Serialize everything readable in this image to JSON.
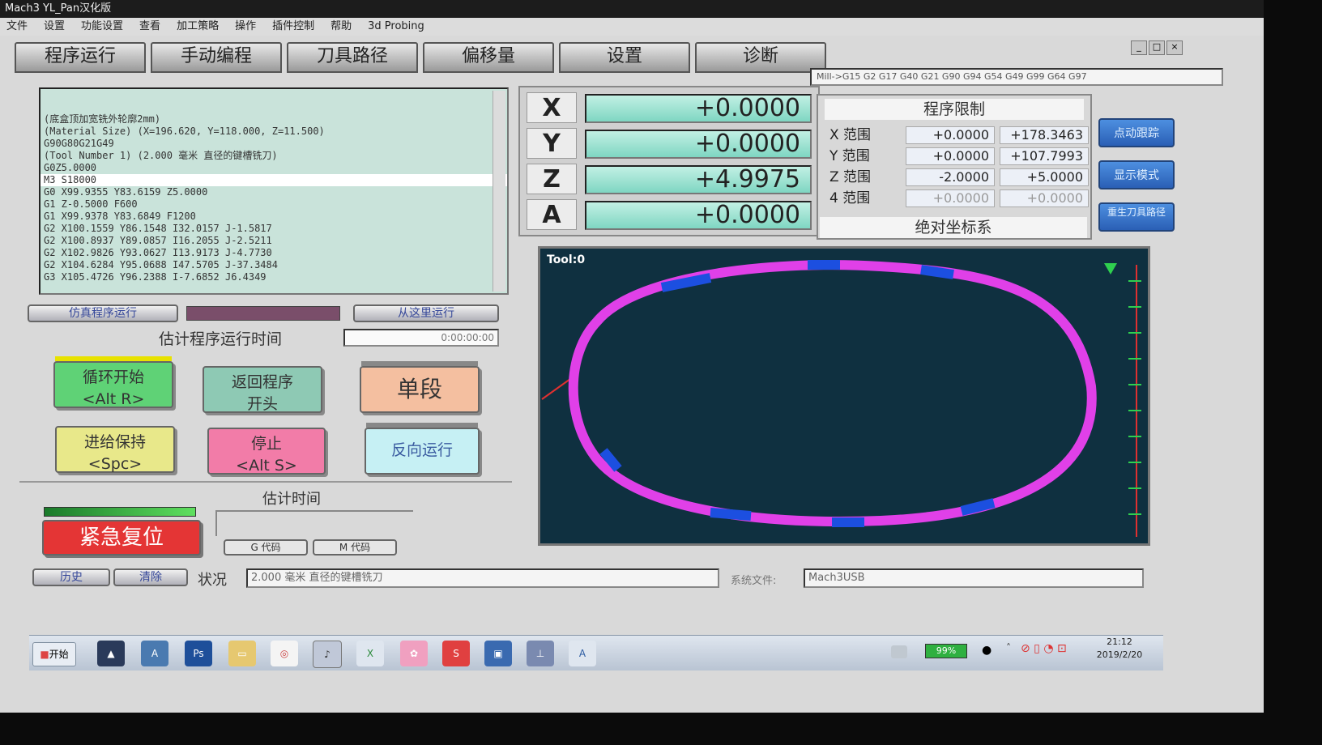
{
  "window": {
    "title": "Mach3 YL_Pan汉化版"
  },
  "menu": [
    "文件",
    "设置",
    "功能设置",
    "查看",
    "加工策略",
    "操作",
    "插件控制",
    "帮助",
    "3d Probing"
  ],
  "tabs": [
    "程序运行",
    "手动编程",
    "刀具路径",
    "偏移量",
    "设置",
    "诊断"
  ],
  "modal_line": "Mill->G15  G2 G17 G40 G21 G90 G94 G54 G49 G99 G64 G97",
  "gcode_lines": [
    "",
    "",
    "(底盒顶加宽铣外轮廓2mm)",
    "(Material Size) (X=196.620, Y=118.000, Z=11.500)",
    "G90G80G21G49",
    "(Tool Number 1) (2.000 毫米 直径的键槽铣刀)",
    "G0Z5.0000",
    "M3 S18000",
    "G0 X99.9355 Y83.6159 Z5.0000",
    "G1   Z-0.5000 F600",
    "G1 X99.9378 Y83.6849  F1200",
    "G2 X100.1559 Y86.1548 I32.0157 J-1.5817",
    "G2 X100.8937 Y89.0857 I16.2055 J-2.5211",
    "G2 X102.9826 Y93.0627 I13.9173 J-4.7730",
    "G2 X104.6284 Y95.0688 I47.5705 J-37.3484",
    "G3 X105.4726 Y96.2388 I-7.6852 J6.4349"
  ],
  "gcode_selected_index": 7,
  "controls": {
    "simulate": "仿真程序运行",
    "run_from_here": "从这里运行",
    "est_time_label": "估计程序运行时间",
    "est_time_value": "0:00:00:00",
    "cycle_start": "循环开始\n<Alt R>",
    "rewind": "返回程序\n开头",
    "single_block": "单段",
    "feed_hold": "进给保持\n<Spc>",
    "stop": "停止\n<Alt S>",
    "reverse_run": "反向运行",
    "est_time2": "估计时间",
    "estop": "紧急复位",
    "gcodes": "G 代码",
    "mcodes": "M 代码"
  },
  "dro": [
    {
      "axis": "X",
      "value": "+0.0000"
    },
    {
      "axis": "Y",
      "value": "+0.0000"
    },
    {
      "axis": "Z",
      "value": "+4.9975"
    },
    {
      "axis": "A",
      "value": "+0.0000"
    }
  ],
  "limits": {
    "title": "程序限制",
    "rows": [
      {
        "label": "X 范围",
        "min": "+0.0000",
        "max": "+178.3463"
      },
      {
        "label": "Y 范围",
        "min": "+0.0000",
        "max": "+107.7993"
      },
      {
        "label": "Z 范围",
        "min": "-2.0000",
        "max": "+5.0000"
      },
      {
        "label": "4 范围",
        "min": "+0.0000",
        "max": "+0.0000"
      }
    ],
    "coord": "绝对坐标系"
  },
  "side_buttons": [
    "点动跟踪",
    "显示模式",
    "重生刀具路径"
  ],
  "toolpath": {
    "label": "Tool:0"
  },
  "status": {
    "history": "历史",
    "clear": "清除",
    "label": "状况",
    "value": "2.000 毫米 直径的键槽铣刀",
    "file_label": "系统文件:",
    "file_value": "Mach3USB"
  },
  "taskbar": {
    "start": "开始",
    "battery": "99%",
    "time": "21:12",
    "date": "2019/2/20"
  },
  "colors": {
    "path_magenta": "#e040e8",
    "path_blue": "#1c4fe0",
    "dro_bg": "#8fe0cc"
  }
}
